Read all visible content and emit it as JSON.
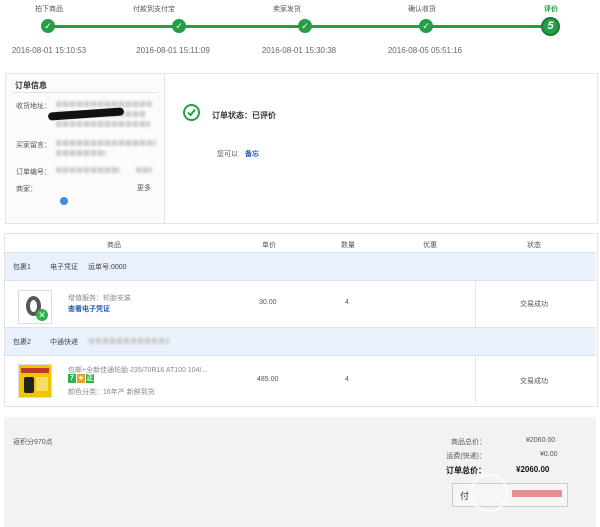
{
  "progress": {
    "steps": [
      {
        "label": "拍下商品",
        "time": "2016-08-01 15:10:53",
        "mark": "✓"
      },
      {
        "label": "付款到支付宝",
        "time": "2016-08-01 15:11:09",
        "mark": "✓"
      },
      {
        "label": "卖家发货",
        "time": "2016-08-01 15:30:38",
        "mark": "✓"
      },
      {
        "label": "确认收货",
        "time": "2016-08-05 05:51:16",
        "mark": "✓"
      },
      {
        "label": "评价",
        "time": "",
        "mark": "5"
      }
    ],
    "color": "#23a046"
  },
  "order_info": {
    "title": "订单信息",
    "address_label": "收货地址：",
    "message_label": "买家留言：",
    "order_no_label": "订单编号：",
    "merchant_label": "商家：",
    "more": "更多"
  },
  "status": {
    "text": "订单状态：已评价",
    "sub": "您可以",
    "link": "备忘"
  },
  "table": {
    "headers": [
      "商品",
      "单价",
      "数量",
      "优惠",
      "状态"
    ]
  },
  "packages": [
    {
      "name": "包裹1",
      "type": "电子凭证",
      "waybill": "运单号:0000"
    },
    {
      "name": "包裹2",
      "type": "中通快递",
      "waybill": ""
    }
  ],
  "items": [
    {
      "name": "增值服务：轮胎安装",
      "link": "查看电子凭证",
      "price": "30.00",
      "qty": "4",
      "status": "交易成功"
    },
    {
      "name": "包邮+全新佳通轮胎 235/70R16 AT100 104/...",
      "variant": "颜色分类：16年产 新鲜到货",
      "price": "485.00",
      "qty": "4",
      "status": "交易成功",
      "badges": [
        {
          "t": "7",
          "c": "#2bb24c"
        },
        {
          "t": "★",
          "c": "#2bb24c"
        },
        {
          "t": "正",
          "c": "#2bb24c"
        }
      ]
    }
  ],
  "summary": {
    "points": "返积分970点",
    "goods_label": "商品总价：",
    "goods_value": "¥2060.00",
    "shipping_label": "运费(快递)：",
    "shipping_value": "¥0.00",
    "total_label": "订单总价：",
    "total_value": "¥2060.00",
    "pay_label": "付"
  }
}
